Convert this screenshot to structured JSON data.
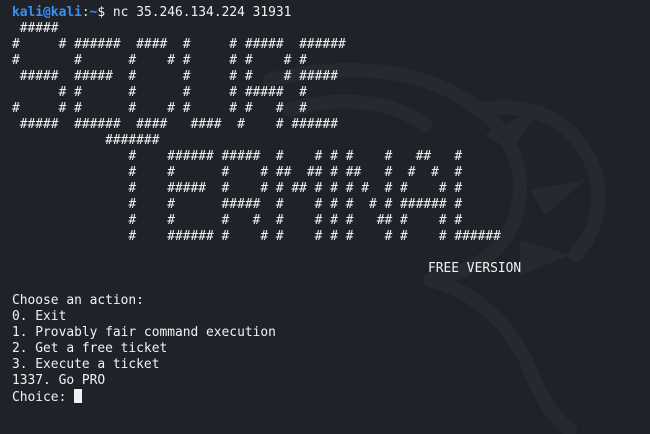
{
  "terminal": {
    "prompt": {
      "user_host": "kali@kali",
      "separator": ":",
      "path": "~",
      "symbol": "$",
      "command": "nc 35.246.134.224 31931"
    },
    "banner": [
      " #####",
      "#     # ######  ####  #     # #####  ######",
      "#       #      #    # #     # #    # #",
      " #####  #####  #      #     # #    # #####",
      "      # #      #      #     # #####  #",
      "#     # #      #    # #     # #   #  #",
      " #####  ######  ####   ####  #    # ######",
      "            #######",
      "               #    ###### #####  #    # # #    #   ##   #",
      "               #    #      #    # ##  ## # ##   #  #  #  #",
      "               #    #####  #    # # ## # # # #  # #    # #",
      "               #    #      #####  #    # # #  # # ###### #",
      "               #    #      #   #  #    # # #   ## #    # #",
      "               #    ###### #    # #    # # #    # #    # ######"
    ],
    "edition": "FREE VERSION",
    "menu": {
      "heading": "Choose an action:",
      "options": [
        "0. Exit",
        "1. Provably fair command execution",
        "2. Get a free ticket",
        "3. Execute a ticket",
        "1337. Go PRO"
      ],
      "prompt_label": "Choice:"
    }
  },
  "colors": {
    "background": "#1f2329",
    "prompt_blue": "#3d8ef5",
    "text": "#f2f2f2",
    "watermark": "#2b3038"
  },
  "icons": {
    "watermark": "kali-dragon-icon",
    "cursor": "block-cursor"
  }
}
